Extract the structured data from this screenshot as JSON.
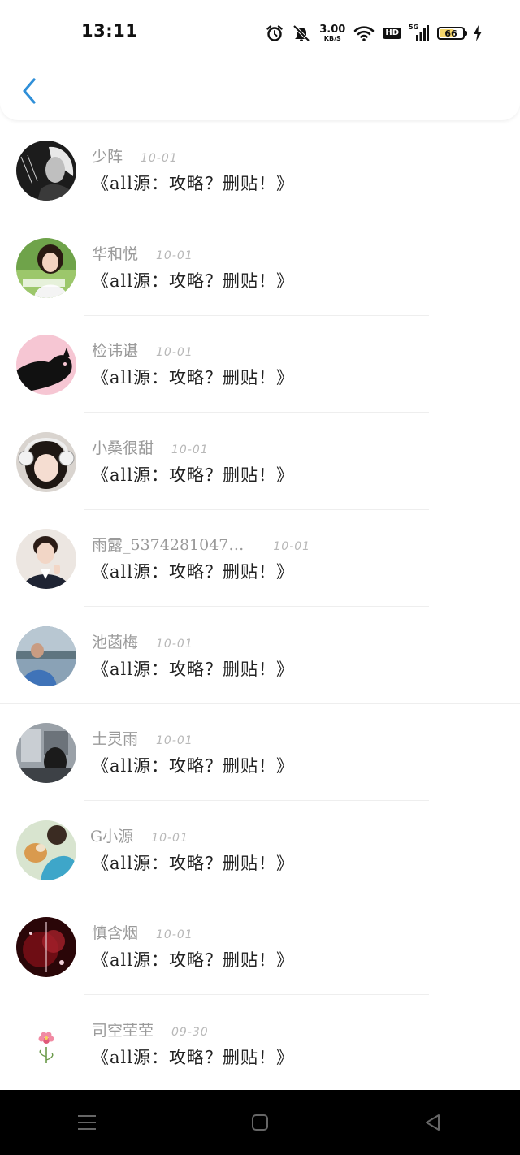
{
  "status_bar": {
    "time": "13:11",
    "net_speed_value": "3.00",
    "net_speed_unit": "KB/S",
    "hd_label": "HD",
    "signal_label": "5G",
    "battery_level": "66",
    "icons": [
      "alarm-icon",
      "mute-bell-icon",
      "wifi-icon",
      "hd-icon",
      "signal-5g-icon",
      "battery-icon",
      "charging-icon"
    ]
  },
  "header": {
    "back_icon": "chevron-left-icon",
    "accent_color": "#2f8fd8"
  },
  "messages": [
    {
      "name": "少阵",
      "date": "10-01",
      "text": "《all源：攻略？删贴！》",
      "avatar": "bw-portrait"
    },
    {
      "name": "华和悦",
      "date": "10-01",
      "text": "《all源：攻略？删贴！》",
      "avatar": "girl-green"
    },
    {
      "name": "检讳谌",
      "date": "10-01",
      "text": "《all源：攻略？删贴！》",
      "avatar": "pink-cat"
    },
    {
      "name": "小桑很甜",
      "date": "10-01",
      "text": "《all源：攻略？删贴！》",
      "avatar": "girl-headphones"
    },
    {
      "name": "雨露_5374281047…",
      "date": "10-01",
      "text": "《all源：攻略？删贴！》",
      "avatar": "boy-suit"
    },
    {
      "name": "池菡梅",
      "date": "10-01",
      "text": "《all源：攻略？删贴！》",
      "avatar": "man-lake"
    },
    {
      "name": "士灵雨",
      "date": "10-01",
      "text": "《all源：攻略？删贴！》",
      "avatar": "room-dark"
    },
    {
      "name": "G小源",
      "date": "10-01",
      "text": "《all源：攻略？删贴！》",
      "avatar": "dog-blue"
    },
    {
      "name": "慎含烟",
      "date": "10-01",
      "text": "《all源：攻略？删贴！》",
      "avatar": "dark-red"
    },
    {
      "name": "司空茔茔",
      "date": "09-30",
      "text": "《all源：攻略？删贴！》",
      "avatar": "pink-flower"
    }
  ],
  "nav_bar": {
    "icons": [
      "menu-icon",
      "home-square-icon",
      "back-triangle-icon"
    ]
  }
}
